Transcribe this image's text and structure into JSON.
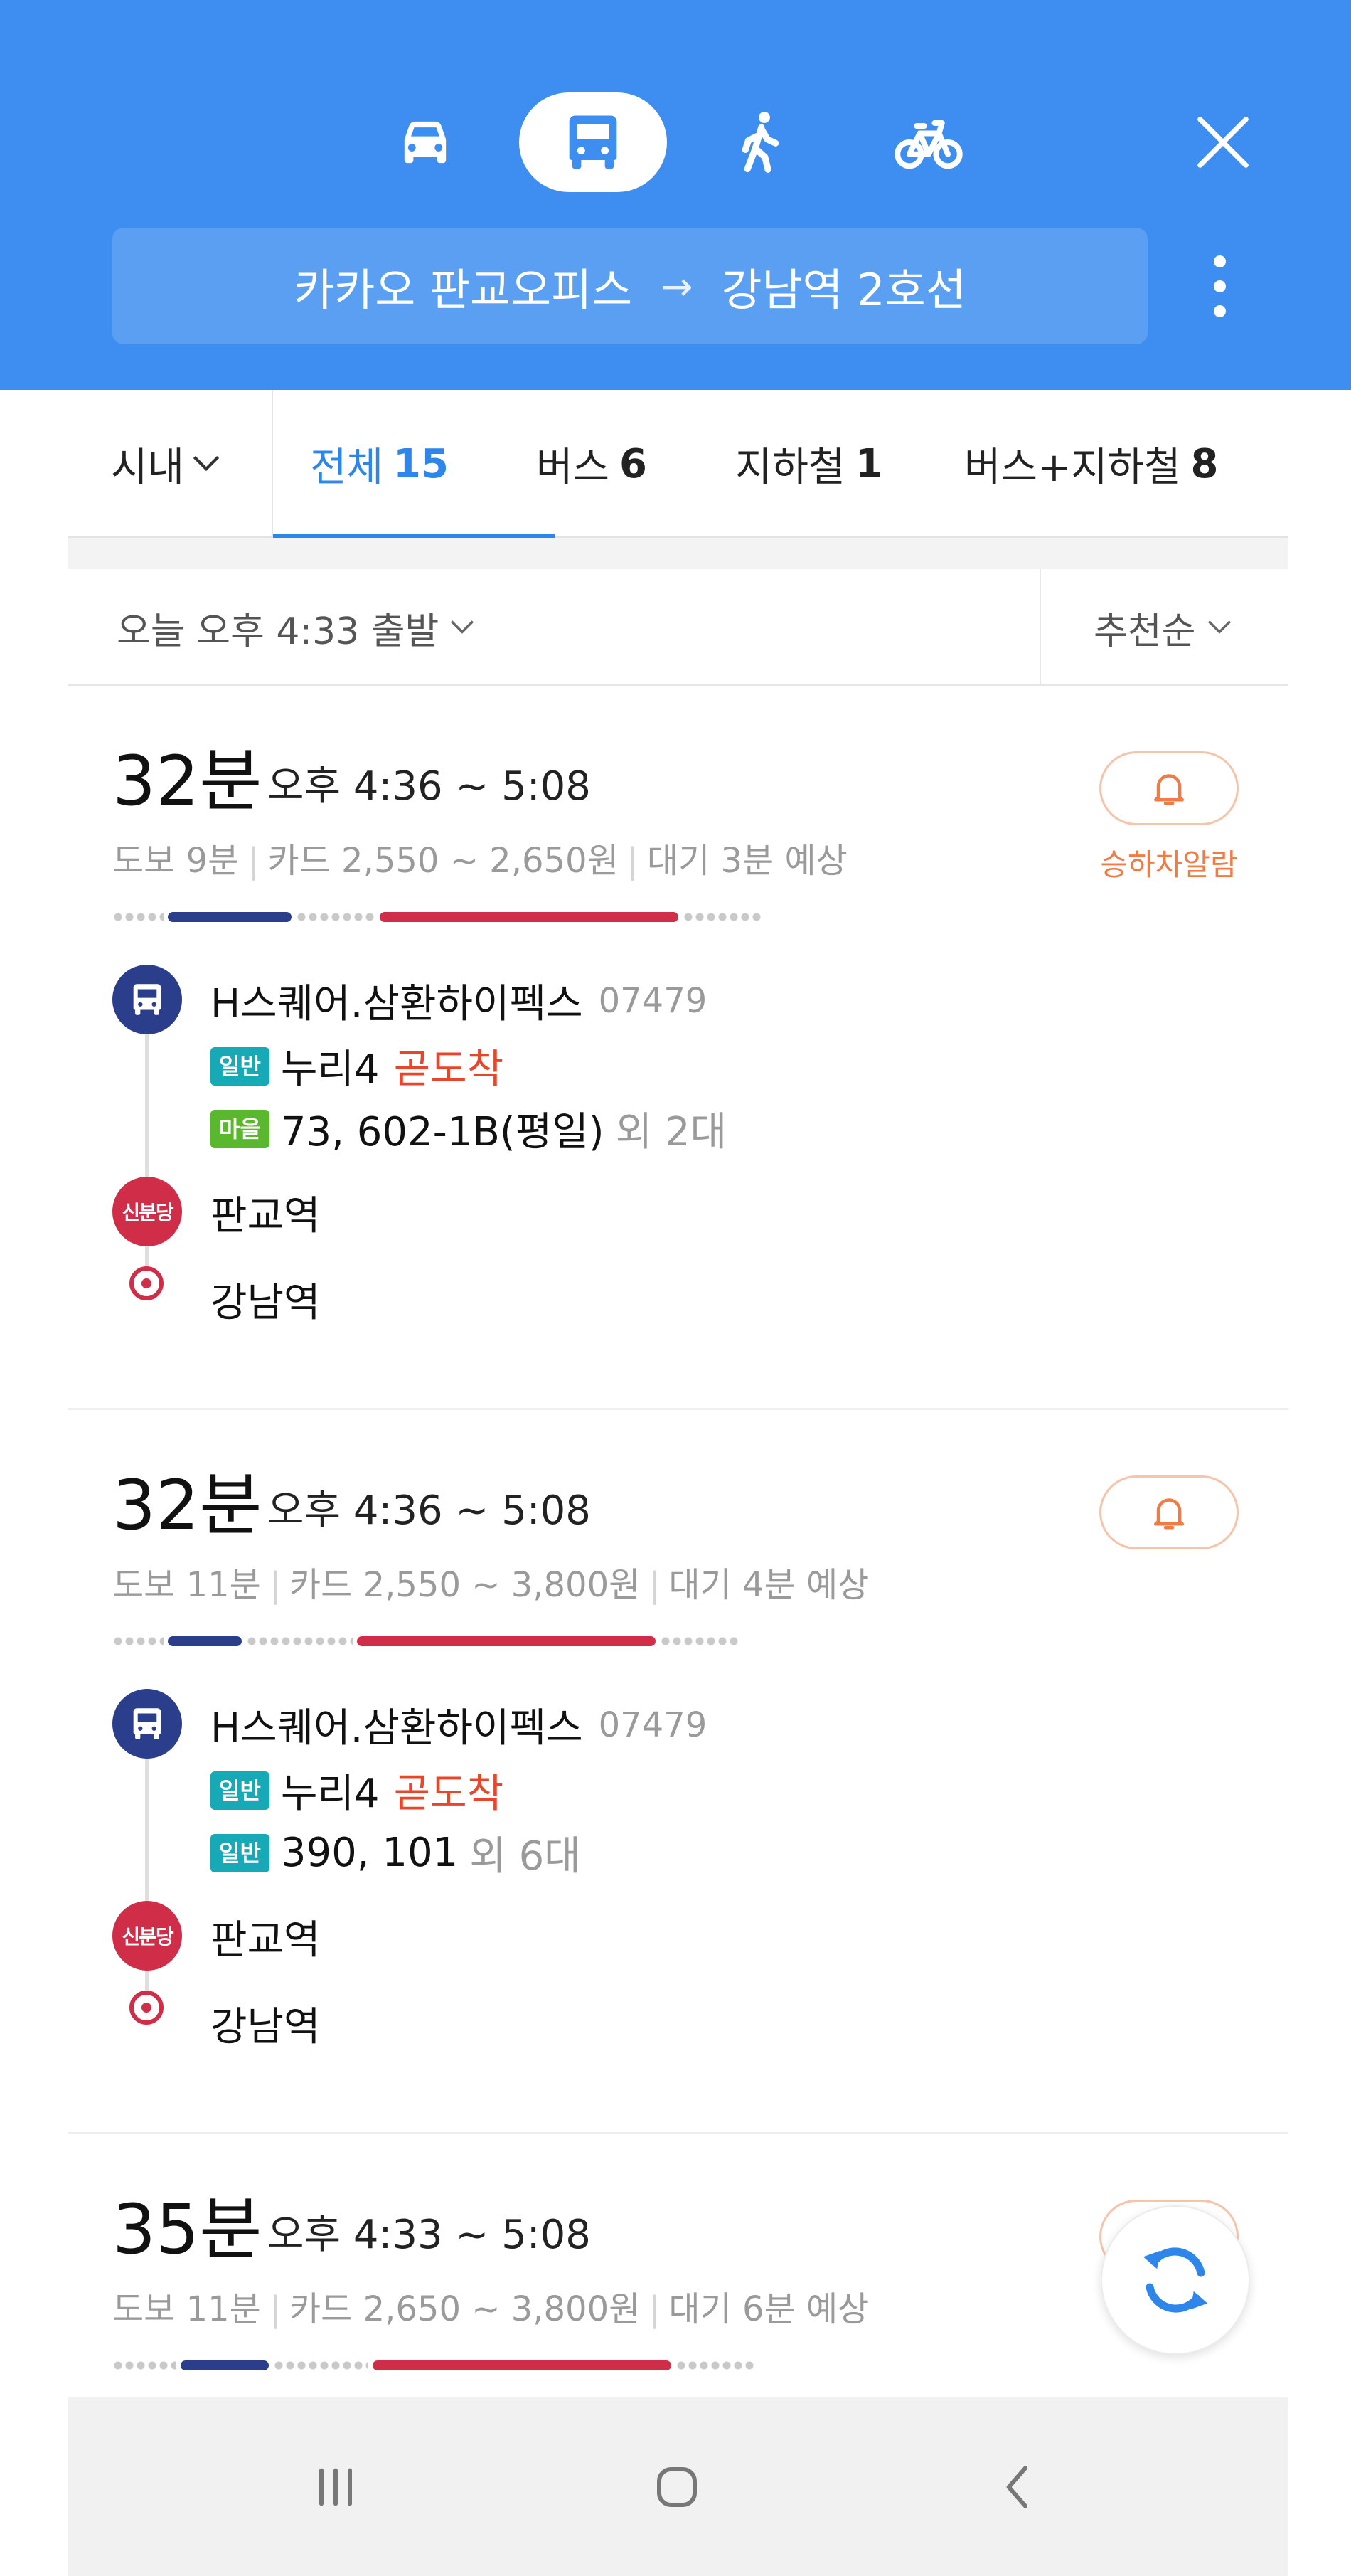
{
  "colors": {
    "header_blue": "#3d8ef0",
    "accent_blue": "#2e86ea",
    "bus_navy": "#2b3e8c",
    "subway_red": "#d02e48",
    "late_red": "#e8452a",
    "alarm_orange": "#f07b45",
    "tag_normal": "#17a9b5",
    "tag_village": "#59b82d"
  },
  "header": {
    "modes": [
      {
        "icon": "car-icon",
        "active": false
      },
      {
        "icon": "bus-icon",
        "active": true
      },
      {
        "icon": "walk-icon",
        "active": false
      },
      {
        "icon": "bike-icon",
        "active": false
      }
    ],
    "origin": "카카오 판교오피스",
    "arrow": "→",
    "destination": "강남역 2호선"
  },
  "tabs": {
    "region": "시내",
    "items": [
      {
        "label": "전체",
        "count": "15",
        "active": true
      },
      {
        "label": "버스",
        "count": "6",
        "active": false
      },
      {
        "label": "지하철",
        "count": "1",
        "active": false
      },
      {
        "label": "버스+지하철",
        "count": "8",
        "active": false
      }
    ]
  },
  "sortbar": {
    "departure": "오늘 오후 4:33 출발",
    "sort": "추천순"
  },
  "routes": [
    {
      "duration": "32분",
      "time_range": "오후 4:36 ~ 5:08",
      "walk": "도보 9분",
      "fare": "카드 2,550 ~ 2,650원",
      "wait": "대기 3분 예상",
      "alarm_label": "승하차알람",
      "board_stop": "H스퀘어.삼환하이펙스",
      "stop_code": "07479",
      "lines": [
        {
          "tag": "일반",
          "tag_type": "normal",
          "name": "누리4",
          "status": "곧도착",
          "extra": ""
        },
        {
          "tag": "마을",
          "tag_type": "village",
          "name": "73, 602-1B(평일)",
          "status": "",
          "extra": "외 2대"
        }
      ],
      "transfer_line_badge": "신분당",
      "transfer_station": "판교역",
      "arrival_station": "강남역"
    },
    {
      "duration": "32분",
      "time_range": "오후 4:36 ~ 5:08",
      "walk": "도보 11분",
      "fare": "카드 2,550 ~ 3,800원",
      "wait": "대기 4분 예상",
      "board_stop": "H스퀘어.삼환하이펙스",
      "stop_code": "07479",
      "lines": [
        {
          "tag": "일반",
          "tag_type": "normal",
          "name": "누리4",
          "status": "곧도착",
          "extra": ""
        },
        {
          "tag": "일반",
          "tag_type": "normal",
          "name": "390, 101",
          "status": "",
          "extra": "외 6대"
        }
      ],
      "transfer_line_badge": "신분당",
      "transfer_station": "판교역",
      "arrival_station": "강남역"
    },
    {
      "duration": "35분",
      "time_range": "오후 4:33 ~ 5:08",
      "walk": "도보 11분",
      "fare": "카드 2,650 ~ 3,800원",
      "wait": "대기 6분 예상"
    }
  ]
}
